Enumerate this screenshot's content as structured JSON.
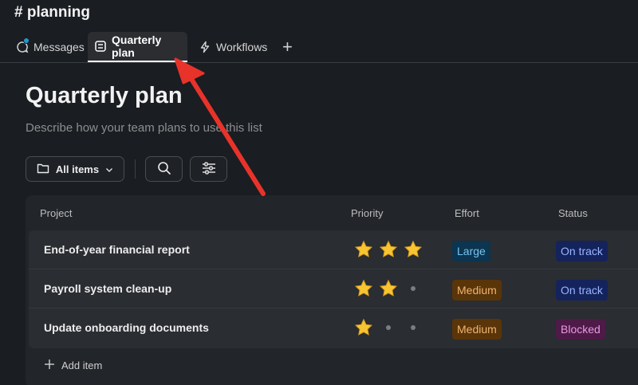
{
  "channel": {
    "title": "# planning"
  },
  "tabs": [
    {
      "label": "Messages",
      "icon": "chat-bubble-icon",
      "has_badge": true
    },
    {
      "label": "Quarterly plan",
      "icon": "list-icon",
      "active": true
    },
    {
      "label": "Workflows",
      "icon": "lightning-icon"
    },
    {
      "label": "+",
      "icon": "plus-icon"
    }
  ],
  "page": {
    "title": "Quarterly plan",
    "description": "Describe how your team plans to use this list"
  },
  "toolbar": {
    "view_label": "All items",
    "view_icon": "folder-icon",
    "search_icon": "search-icon",
    "filter_icon": "sliders-icon"
  },
  "table": {
    "columns": [
      "Project",
      "Priority",
      "Effort",
      "Status"
    ],
    "rows": [
      {
        "project": "End-of-year financial report",
        "priority": 3,
        "effort": "Large",
        "status": "On track"
      },
      {
        "project": "Payroll system clean-up",
        "priority": 2,
        "effort": "Medium",
        "status": "On track"
      },
      {
        "project": "Update onboarding documents",
        "priority": 1,
        "effort": "Medium",
        "status": "Blocked"
      }
    ],
    "add_item_label": "Add item"
  },
  "colors": {
    "background": "#1a1d21",
    "annotation_arrow": "#e8332a",
    "tag_large": "#0b3550",
    "tag_medium": "#5a3509",
    "tag_on_track": "#14235c",
    "tag_blocked": "#4e1a48"
  }
}
